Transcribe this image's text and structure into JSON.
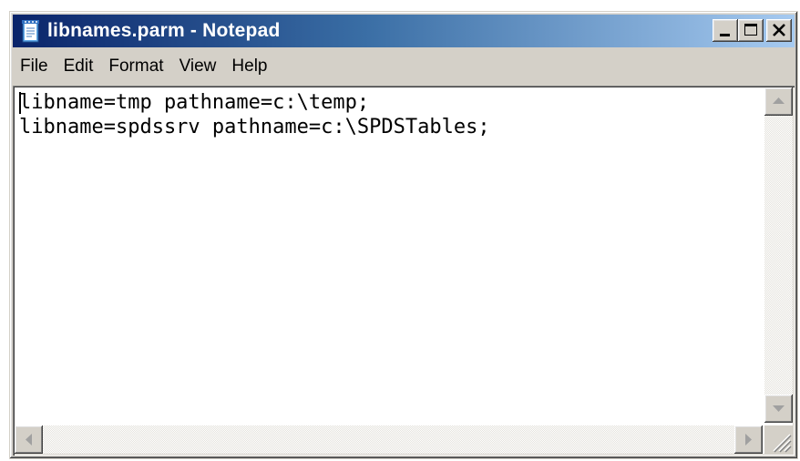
{
  "window": {
    "title": "libnames.parm - Notepad",
    "icon": "notepad-icon",
    "controls": [
      "minimize-icon",
      "maximize-icon",
      "close-icon"
    ]
  },
  "menu": {
    "file": "File",
    "edit": "Edit",
    "format": "Format",
    "view": "View",
    "help": "Help"
  },
  "editor": {
    "lines": [
      "libname=tmp pathname=c:\\temp;",
      "libname=spdssrv pathname=c:\\SPDSTables;"
    ]
  },
  "colors": {
    "title_gradient_start": "#0a246a",
    "title_gradient_end": "#a6caf0",
    "face": "#d4d0c8"
  }
}
